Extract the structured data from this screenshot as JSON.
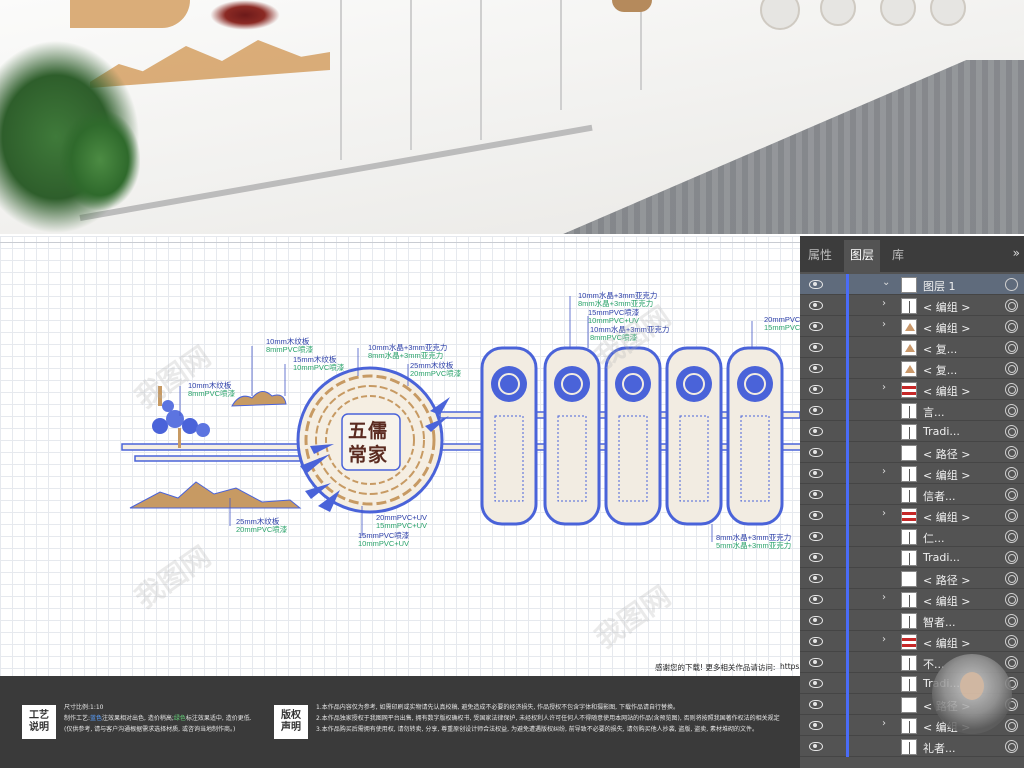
{
  "design": {
    "seal_line1": "五儒",
    "seal_line2": "常家",
    "annotations": [
      {
        "l1": "10mm木纹板",
        "l2": "8mmPVC喷漆"
      },
      {
        "l1": "10mm木纹板",
        "l2": "8mmPVC喷漆"
      },
      {
        "l1": "15mm木纹板",
        "l2": "10mmPVC喷漆"
      },
      {
        "l1": "10mm水晶+3mm亚克力",
        "l2": "8mm水晶+3mm亚克力"
      },
      {
        "l1": "25mm木纹板",
        "l2": "20mmPVC喷漆"
      },
      {
        "l1": "10mm水晶+3mm亚克力",
        "l2": "8mm水晶+3mm亚克力"
      },
      {
        "l1": "15mmPVC喷漆",
        "l2": "10mmPVC+UV"
      },
      {
        "l1": "10mm水晶+3mm亚克力",
        "l2": "8mmPVC喷漆"
      },
      {
        "l1": "20mmPVC喷漆",
        "l2": "15mmPVC+UV"
      },
      {
        "l1": "25mm木纹板",
        "l2": "20mmPVC喷漆"
      },
      {
        "l1": "20mmPVC+UV",
        "l2": "15mmPVC+UV"
      },
      {
        "l1": "15mmPVC喷漆",
        "l2": "10mmPVC+UV"
      },
      {
        "l1": "8mm水晶+3mm亚克力",
        "l2": "5mm水晶+3mm亚克力"
      }
    ]
  },
  "footer": {
    "thanks": "感谢您的下载! 更多相关作品请访问:",
    "url": "https://699pic.com/tuku/...",
    "craft_title_1": "工艺",
    "craft_title_2": "说明",
    "scale": "尺寸比例:1:10",
    "craft_line_1_pre": "制作工艺:",
    "craft_blue": "蓝色",
    "craft_line_1_mid": "注效果相对出色, 造价稍高;",
    "craft_green": "绿色",
    "craft_line_1_post": "标注效果适中, 造价更低.",
    "craft_line_2": "(仅供参考, 请与客户沟通根据需求选择材质, 或咨询当地制作商。)",
    "copyright_title_1": "版权",
    "copyright_title_2": "声明",
    "copyright_1": "1.本作品内容仅为参考, 如需印刷或实物请先认真校稿, 避免造成不必要的经济损失, 作品授权不包含字体和摄影图, 下载作品请自行替换。",
    "copyright_2": "2.本作品独家授权于我图网平台出售, 拥有数字版权确权书, 受国家法律保护, 未经权利人许可任何人不得随意使用本网站的作品(含预览图), 否则将按照我国著作权法的相关规定",
    "copyright_3": "3.本作品购买后需拥有使用权, 请勿转卖, 分享, 尊重原创设计师合法权益, 为避免遭遇版权纠纷, 前导致不必要的损失, 请勿购买他人抄袭, 盗版, 盗卖, 素材堆砌的文件。"
  },
  "panel": {
    "tabs": [
      "属性",
      "图层",
      "库"
    ],
    "active_tab": "图层",
    "more": "»",
    "layers": [
      {
        "name": "图层 1",
        "thumb": "plain",
        "chevron": "⌄",
        "kind": "top"
      },
      {
        "name": "< 编组 >",
        "thumb": "line",
        "chevron": "›"
      },
      {
        "name": "< 编组 >",
        "thumb": "brown",
        "chevron": "›"
      },
      {
        "name": "< 复...",
        "thumb": "brown",
        "chevron": ""
      },
      {
        "name": "< 复...",
        "thumb": "brown",
        "chevron": ""
      },
      {
        "name": "< 编组 >",
        "thumb": "red",
        "chevron": "›"
      },
      {
        "name": "言...",
        "thumb": "line",
        "chevron": ""
      },
      {
        "name": "Tradi...",
        "thumb": "line",
        "chevron": ""
      },
      {
        "name": "< 路径 >",
        "thumb": "plain",
        "chevron": ""
      },
      {
        "name": "< 编组 >",
        "thumb": "line",
        "chevron": "›"
      },
      {
        "name": "信者...",
        "thumb": "line",
        "chevron": ""
      },
      {
        "name": "< 编组 >",
        "thumb": "red",
        "chevron": "›"
      },
      {
        "name": "仁...",
        "thumb": "line",
        "chevron": ""
      },
      {
        "name": "Tradi...",
        "thumb": "line",
        "chevron": ""
      },
      {
        "name": "< 路径 >",
        "thumb": "plain",
        "chevron": ""
      },
      {
        "name": "< 编组 >",
        "thumb": "line",
        "chevron": "›"
      },
      {
        "name": "智者...",
        "thumb": "line",
        "chevron": ""
      },
      {
        "name": "< 编组 >",
        "thumb": "red",
        "chevron": "›"
      },
      {
        "name": "不...",
        "thumb": "line",
        "chevron": ""
      },
      {
        "name": "Tradi...",
        "thumb": "line",
        "chevron": ""
      },
      {
        "name": "< 路径 >",
        "thumb": "plain",
        "chevron": ""
      },
      {
        "name": "< 编组 >",
        "thumb": "line",
        "chevron": "›"
      },
      {
        "name": "礼者...",
        "thumb": "line",
        "chevron": ""
      }
    ]
  },
  "watermark": "我图网"
}
